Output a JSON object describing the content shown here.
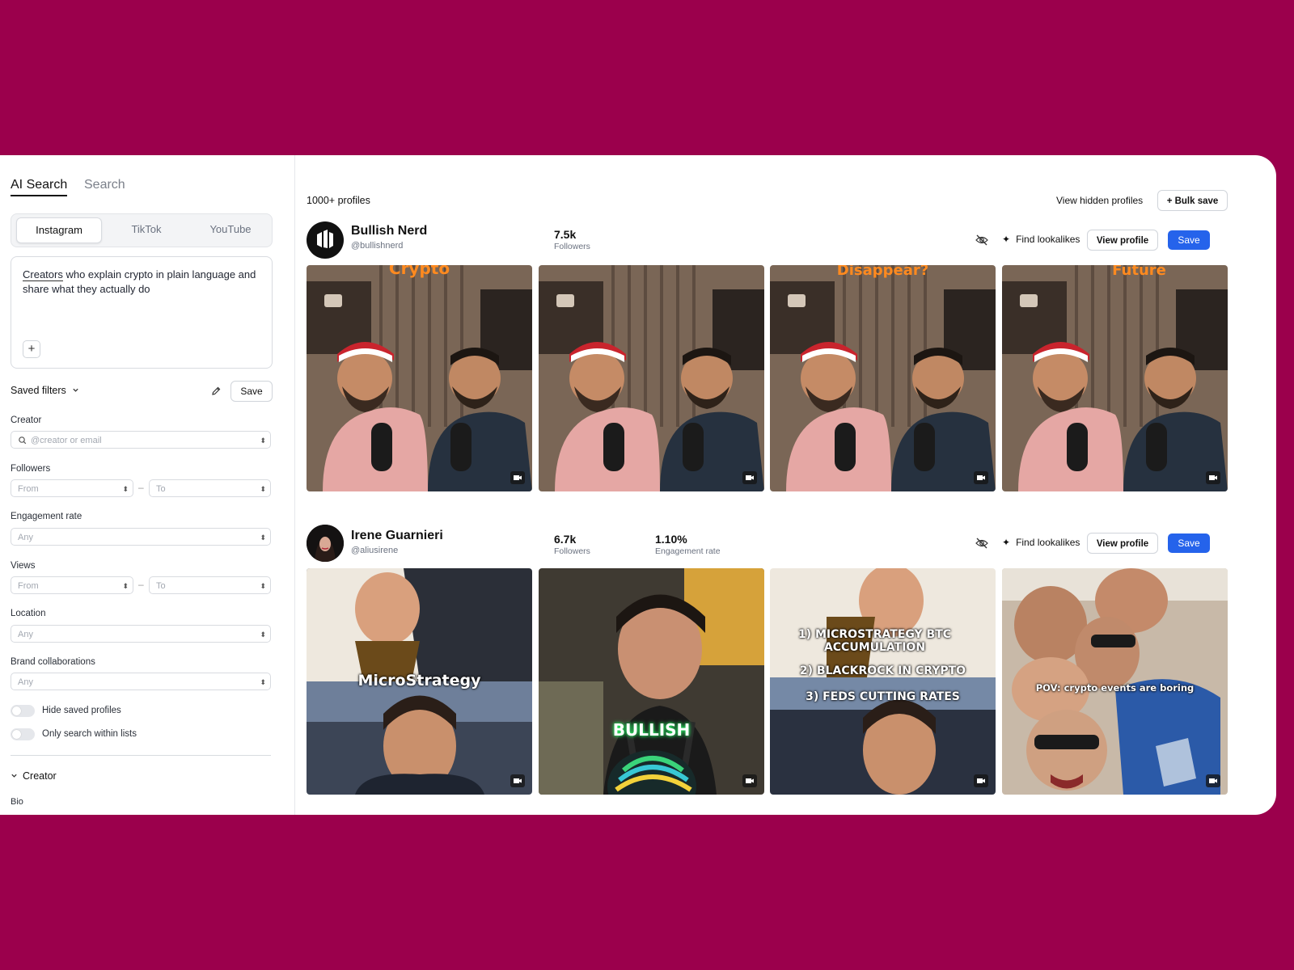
{
  "sidebar": {
    "tabs": [
      "AI Search",
      "Search"
    ],
    "platforms": [
      "Instagram",
      "TikTok",
      "YouTube"
    ],
    "query_first_word": "Creators",
    "query_rest": " who explain crypto in plain language and share what they actually do",
    "plus_label": "+",
    "saved_filters_label": "Saved filters",
    "save_label": "Save",
    "creator_label": "Creator",
    "creator_placeholder": "@creator or email",
    "followers_label": "Followers",
    "from_placeholder": "From",
    "to_placeholder": "To",
    "engagement_label": "Engagement rate",
    "any_placeholder": "Any",
    "views_label": "Views",
    "location_label": "Location",
    "brand_label": "Brand collaborations",
    "hide_saved_label": "Hide saved profiles",
    "only_lists_label": "Only search within lists",
    "section_creator": "Creator",
    "bio_label": "Bio"
  },
  "main": {
    "count": "1000+ profiles",
    "view_hidden": "View hidden profiles",
    "bulk_save": "+ Bulk save",
    "find_lookalikes": "Find lookalikes",
    "view_profile": "View profile",
    "save": "Save",
    "profiles": [
      {
        "name": "Bullish Nerd",
        "handle": "@bullishnerd",
        "followers": "7.5k",
        "followers_label": "Followers",
        "thumb_captions": [
          "Crypto",
          "",
          "Disappear?",
          "Future"
        ]
      },
      {
        "name": "Irene Guarnieri",
        "handle": "@aliusirene",
        "followers": "6.7k",
        "followers_label": "Followers",
        "engagement": "1.10%",
        "engagement_label": "Engagement rate",
        "thumb_captions": [
          "MicroStrategy",
          "BULLISH",
          "1) MICROSTRATEGY BTC ACCUMULATION",
          "POV: crypto events are boring"
        ],
        "thumb_captions_extra": [
          "2) BLACKROCK IN CRYPTO",
          "3) FEDS CUTTING RATES"
        ]
      }
    ]
  },
  "colors": {
    "background": "#9b004c",
    "primary": "#2563eb"
  }
}
